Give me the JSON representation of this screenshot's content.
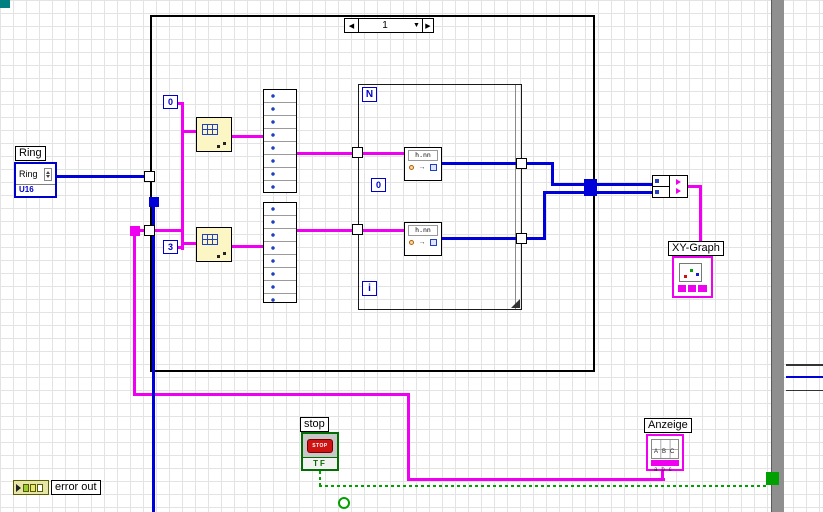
{
  "colors": {
    "wire_pink": "#f000f0",
    "wire_blue": "#0000d8",
    "wire_green": "#00a000",
    "border_blue": "#0000cc",
    "node_yellow": "#fcf6c5",
    "stop_green": "#006e00",
    "stop_red": "#cf1212",
    "teal": "#008080",
    "scrollbar_gray": "#8f8f8f",
    "grid": "#e3e3e3"
  },
  "case_structure": {
    "selector_value": "1"
  },
  "for_loop": {
    "count_label": "N",
    "iterator_label": "i",
    "init_constant": "0"
  },
  "constants": {
    "top": "0",
    "bottom": "3"
  },
  "ring": {
    "label": "Ring",
    "text": "Ring",
    "type": "U16"
  },
  "formula_node": {
    "text": "h.nn"
  },
  "stop": {
    "label": "stop",
    "button_text": "STOP",
    "type_text": "TF"
  },
  "anzeige": {
    "label": "Anzeige",
    "row1": "ABC",
    "row2": "abc"
  },
  "xy_graph": {
    "label": "XY-Graph"
  },
  "error_out": {
    "label": "error out"
  },
  "icons": {
    "case_prev": "◀",
    "case_down": "▼",
    "case_next": "▶",
    "arrow_right": "→"
  }
}
